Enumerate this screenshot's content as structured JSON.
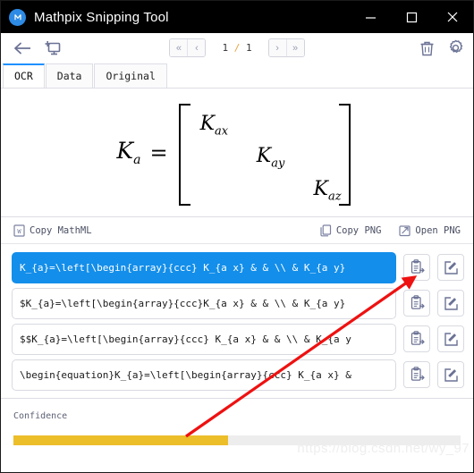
{
  "window": {
    "title": "Mathpix Snipping Tool",
    "logo_icon": "mathpix-logo-icon",
    "controls": {
      "minimize": "minimize-icon",
      "maximize": "maximize-icon",
      "close": "close-icon"
    }
  },
  "toolbar": {
    "back_icon": "back-arrow-icon",
    "new_snip_icon": "new-snip-icon",
    "pager": {
      "first_label": "«",
      "prev_label": "‹",
      "next_label": "›",
      "last_label": "»",
      "current_page": "1",
      "separator": "/",
      "total_pages": "1"
    },
    "delete_icon": "trash-icon",
    "settings_icon": "gear-icon"
  },
  "tabs": [
    {
      "label": "OCR",
      "active": true
    },
    {
      "label": "Data",
      "active": false
    },
    {
      "label": "Original",
      "active": false
    }
  ],
  "preview": {
    "lhs_symbol": "K",
    "lhs_sub": "a",
    "equals": "=",
    "cells": [
      {
        "symbol": "K",
        "sub": "ax"
      },
      {
        "symbol": "K",
        "sub": "ay"
      },
      {
        "symbol": "K",
        "sub": "az"
      }
    ]
  },
  "copybar": {
    "mathml": {
      "label": "Copy MathML",
      "icon": "word-document-icon"
    },
    "copy_png": {
      "label": "Copy PNG",
      "icon": "copy-pages-icon"
    },
    "open_png": {
      "label": "Open PNG",
      "icon": "external-link-icon"
    }
  },
  "results": [
    {
      "text": "K_{a}=\\left[\\begin{array}{ccc} K_{a x} & & \\\\ & K_{a y}",
      "selected": true,
      "copy_icon": "clipboard-copy-icon",
      "edit_icon": "edit-square-icon"
    },
    {
      "text": "$K_{a}=\\left[\\begin{array}{ccc}K_{a x} & & \\\\ & K_{a y}",
      "selected": false,
      "copy_icon": "clipboard-copy-icon",
      "edit_icon": "edit-square-icon"
    },
    {
      "text": "$$K_{a}=\\left[\\begin{array}{ccc} K_{a x} & & \\\\ & K_{a y",
      "selected": false,
      "copy_icon": "clipboard-copy-icon",
      "edit_icon": "edit-square-icon"
    },
    {
      "text": "\\begin{equation}K_{a}=\\left[\\begin{array}{ccc} K_{a x} &",
      "selected": false,
      "copy_icon": "clipboard-copy-icon",
      "edit_icon": "edit-square-icon"
    }
  ],
  "confidence": {
    "label": "Confidence",
    "percent": 48,
    "fill_color": "#ecbe2a",
    "track_color": "#ededed"
  },
  "overlay": {
    "watermark": "https://blog.csdn.net/wy_97",
    "arrow_color": "#ee1111"
  },
  "colors": {
    "titlebar_bg": "#000000",
    "accent_blue": "#138eea",
    "tab_active_underline": "#1e90ff",
    "icon_gray": "#6b7295",
    "page_slash": "#e8a33d"
  }
}
